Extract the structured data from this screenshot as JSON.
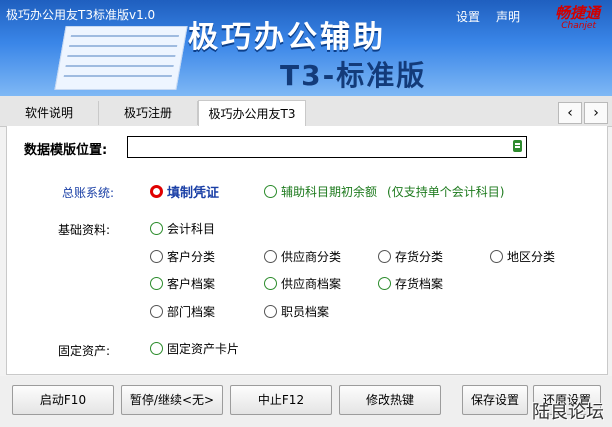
{
  "window": {
    "title": "极巧办公用友T3标准版v1.0"
  },
  "header": {
    "links": [
      "设置",
      "声明"
    ],
    "brand": "畅捷通",
    "brand_sub": "Chanjet",
    "headline1": "极巧办公辅助",
    "headline2": "T3-标准版"
  },
  "tabs": [
    {
      "label": "软件说明"
    },
    {
      "label": "极巧注册"
    },
    {
      "label": "极巧办公用友T3",
      "active": true
    }
  ],
  "tab_nav": {
    "prev": "‹",
    "next": "›"
  },
  "path": {
    "label": "数据模版位置:",
    "value": ""
  },
  "ledger": {
    "label": "总账系统:",
    "options": [
      {
        "label": "填制凭证",
        "checked": true
      },
      {
        "label": "辅助科目期初余额",
        "checked": false
      },
      {
        "label": "(仅支持单个会计科目)",
        "checked": false
      }
    ]
  },
  "basic": {
    "label": "基础资料:",
    "options": [
      "会计科目",
      "客户分类",
      "供应商分类",
      "存货分类",
      "地区分类",
      "客户档案",
      "供应商档案",
      "存货档案",
      "部门档案",
      "职员档案"
    ]
  },
  "fixed": {
    "label": "固定资产:",
    "options": [
      "固定资产卡片"
    ]
  },
  "buttons": [
    "启动F10",
    "暂停/继续<无>",
    "中止F12",
    "修改热键",
    "保存设置",
    "还原设置"
  ],
  "watermark": "陆良论坛",
  "colors": {
    "accent_blue": "#1a3fa6",
    "selected_red": "#e00000",
    "option_green": "#1d7a1d"
  }
}
